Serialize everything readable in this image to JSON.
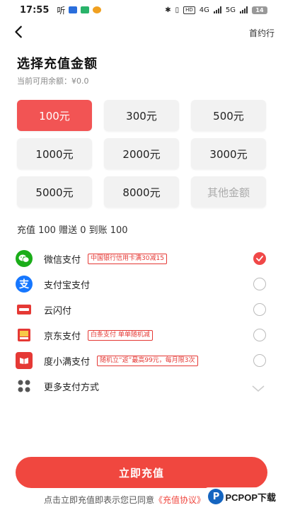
{
  "status_bar": {
    "time": "17:55",
    "left_label": "听",
    "network_badge": "HD",
    "network_4g": "4G",
    "network_5g": "5G",
    "battery": "14"
  },
  "header": {
    "brand": "首约行"
  },
  "page": {
    "title": "选择充值金额",
    "balance": "当前可用余额：¥0.0",
    "bonus_text": "充值 100 赠送 0 到账 100"
  },
  "amounts": [
    {
      "label": "100元",
      "selected": true
    },
    {
      "label": "300元"
    },
    {
      "label": "500元"
    },
    {
      "label": "1000元"
    },
    {
      "label": "2000元"
    },
    {
      "label": "3000元"
    },
    {
      "label": "5000元"
    },
    {
      "label": "8000元"
    },
    {
      "label": "其他金额"
    }
  ],
  "payment_methods": [
    {
      "name": "微信支付",
      "promo": "中国银行信用卡满30减15",
      "checked": true,
      "icon": "wechat-pay-icon",
      "color": "#1aad19"
    },
    {
      "name": "支付宝支付",
      "promo": "",
      "checked": false,
      "icon": "alipay-icon",
      "color": "#1677ff"
    },
    {
      "name": "云闪付",
      "promo": "",
      "checked": false,
      "icon": "unionpay-icon",
      "color": "#e53935"
    },
    {
      "name": "京东支付",
      "promo": "白条支付 单单随机减",
      "checked": false,
      "icon": "jd-pay-icon",
      "color": "#e53935"
    },
    {
      "name": "度小满支付",
      "promo": "随机立“返”最高99元，每月限3次",
      "checked": false,
      "icon": "duxiaoman-pay-icon",
      "color": "#e53935"
    }
  ],
  "more_methods": "更多支付方式",
  "submit_label": "立即充值",
  "agreement": {
    "prefix": "点击立即充值即表示您已同意",
    "link": "《充值协议》"
  },
  "watermark": {
    "logo": "P",
    "text": "PCPOP下载"
  },
  "colors": {
    "accent": "#f0473f",
    "selected_amount": "#f25454",
    "promo": "#e53935"
  }
}
